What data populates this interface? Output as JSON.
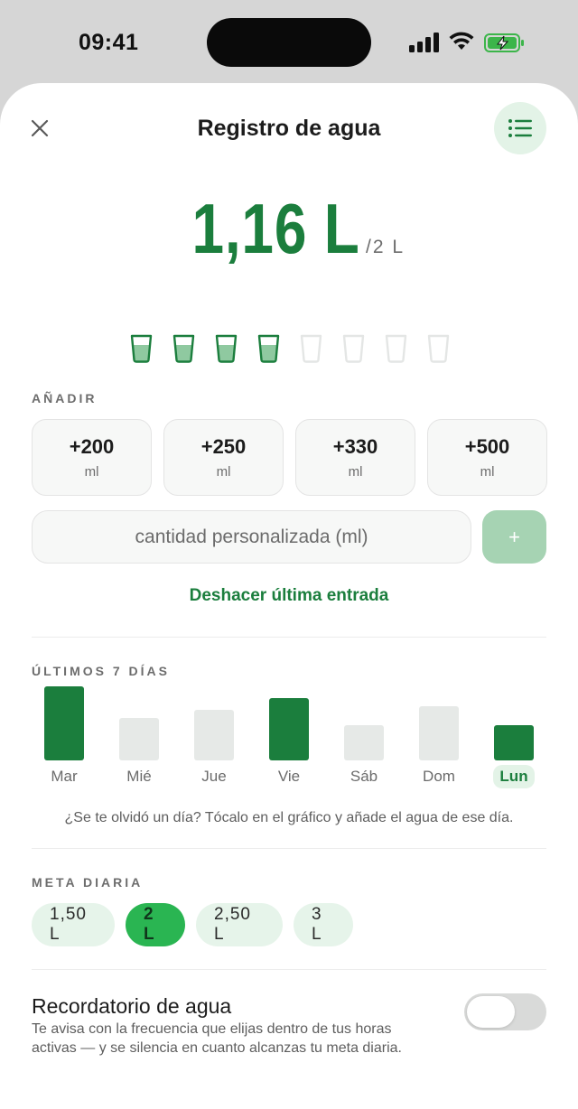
{
  "status_bar": {
    "time": "09:41"
  },
  "header": {
    "title": "Registro de agua",
    "close_icon": "close-icon",
    "list_icon": "list-icon"
  },
  "intake": {
    "value": "1,16 L",
    "goal": "/2 L"
  },
  "glasses": {
    "filled": 4,
    "total": 8
  },
  "add_section": {
    "label": "AÑADIR",
    "quick_amounts": [
      {
        "amount": "+200",
        "unit": "ml"
      },
      {
        "amount": "+250",
        "unit": "ml"
      },
      {
        "amount": "+330",
        "unit": "ml"
      },
      {
        "amount": "+500",
        "unit": "ml"
      }
    ],
    "custom_placeholder": "cantidad personalizada (ml)",
    "add_label": "+",
    "undo_label": "Deshacer última entrada"
  },
  "history": {
    "label": "ÚLTIMOS 7 DÍAS",
    "hint": "¿Se te olvidó un día? Tócalo en el gráfico y añade el agua de ese día.",
    "days": [
      {
        "label": "Mar",
        "value": 1.9,
        "met": true
      },
      {
        "label": "Mié",
        "value": 1.1,
        "met": false
      },
      {
        "label": "Jue",
        "value": 1.3,
        "met": false
      },
      {
        "label": "Vie",
        "value": 1.6,
        "met": true
      },
      {
        "label": "Sáb",
        "value": 0.9,
        "met": false
      },
      {
        "label": "Dom",
        "value": 1.4,
        "met": false
      },
      {
        "label": "Lun",
        "value": 0.9,
        "met": true
      }
    ],
    "selected_day": "Lun",
    "colors": {
      "met": "#1b7e3d",
      "unmet": "#e6e9e7"
    }
  },
  "goal_section": {
    "label": "META DIARIA",
    "options": [
      "1,50 L",
      "2 L",
      "2,50 L",
      "3 L"
    ],
    "selected": "2 L"
  },
  "reminder": {
    "title": "Recordatorio de agua",
    "description": "Te avisa con la frecuencia que elijas dentro de tus horas activas — y se silencia en cuanto alcanzas tu meta diaria.",
    "enabled": false
  },
  "colors": {
    "accent": "#1b7e3d",
    "accent_light": "#e3f3e7",
    "pill_active": "#2ab552"
  }
}
